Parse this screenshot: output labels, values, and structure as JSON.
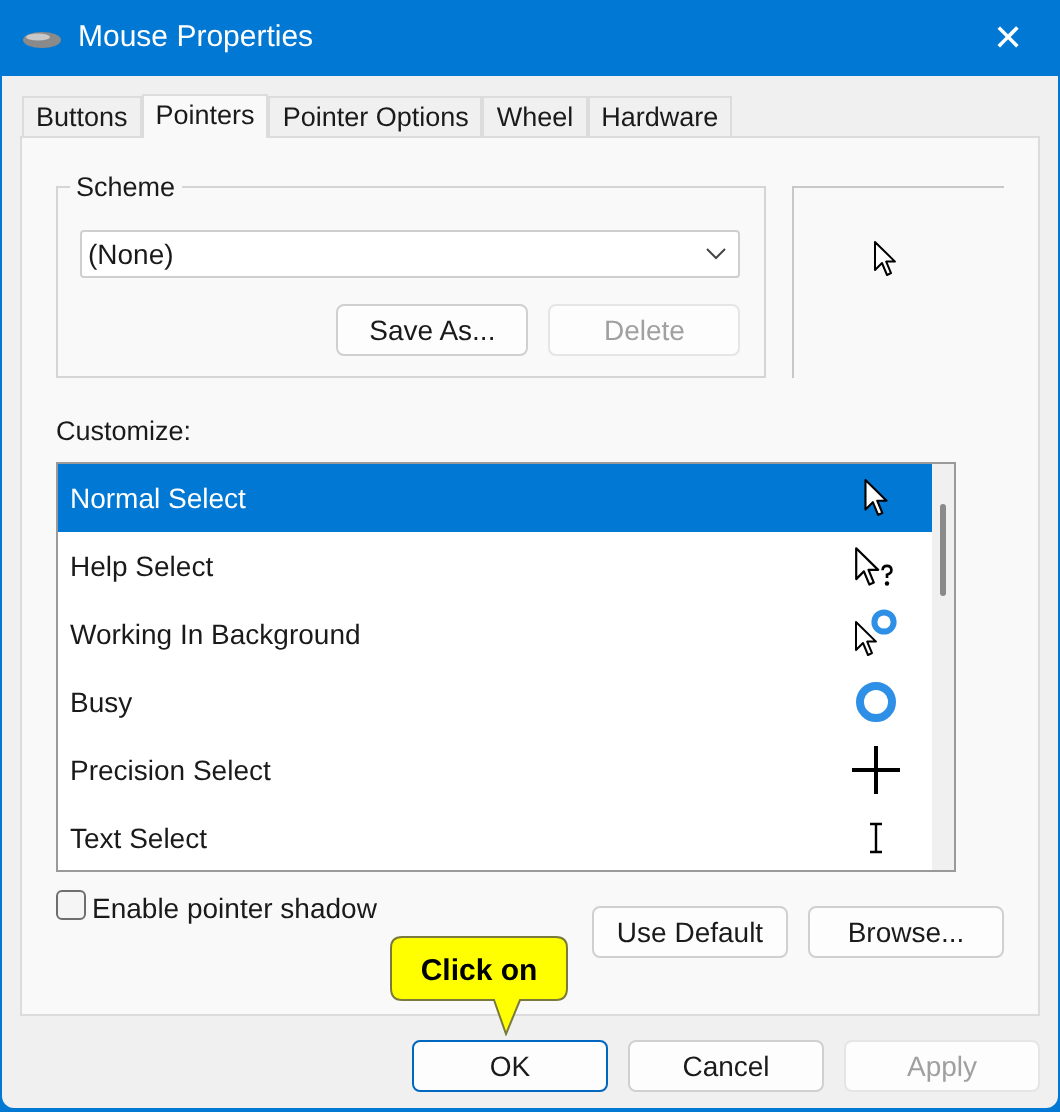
{
  "window": {
    "title": "Mouse Properties",
    "close": "✕"
  },
  "tabs": [
    {
      "label": "Buttons",
      "selected": false
    },
    {
      "label": "Pointers",
      "selected": true
    },
    {
      "label": "Pointer Options",
      "selected": false
    },
    {
      "label": "Wheel",
      "selected": false
    },
    {
      "label": "Hardware",
      "selected": false
    }
  ],
  "scheme": {
    "label": "Scheme",
    "value": "(None)",
    "buttons": [
      {
        "label": "Save As...",
        "disabled": false
      },
      {
        "label": "Delete",
        "disabled": true
      }
    ]
  },
  "customize": {
    "label": "Customize:",
    "items": [
      {
        "name": "Normal Select",
        "kind": "arrow",
        "selected": true
      },
      {
        "name": "Help Select",
        "kind": "help",
        "selected": false
      },
      {
        "name": "Working In Background",
        "kind": "working",
        "selected": false
      },
      {
        "name": "Busy",
        "kind": "busy",
        "selected": false
      },
      {
        "name": "Precision Select",
        "kind": "precision",
        "selected": false
      },
      {
        "name": "Text Select",
        "kind": "text",
        "selected": false
      }
    ]
  },
  "shadow": {
    "label": "Enable pointer shadow",
    "checked": false
  },
  "list_buttons": [
    {
      "label": "Use Default"
    },
    {
      "label": "Browse..."
    }
  ],
  "callout": {
    "text": "Click on"
  },
  "footer": [
    {
      "label": "OK",
      "default": true,
      "disabled": false
    },
    {
      "label": "Cancel",
      "default": false,
      "disabled": false
    },
    {
      "label": "Apply",
      "default": false,
      "disabled": true
    }
  ]
}
